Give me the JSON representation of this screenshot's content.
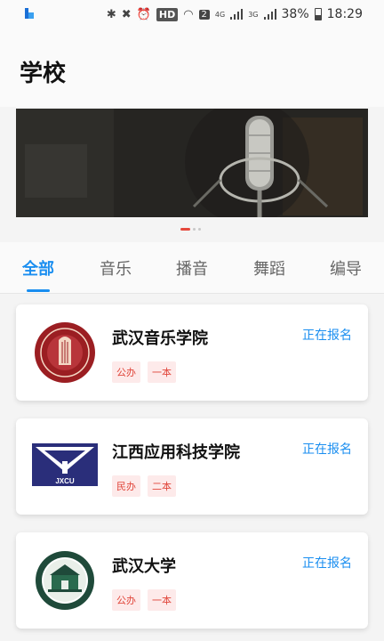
{
  "status_bar": {
    "hd": "HD",
    "sim": "2",
    "net1": "4G",
    "net2": "3G",
    "battery": "38%",
    "time": "18:29"
  },
  "header": {
    "title": "学校"
  },
  "carousel": {
    "slide_count": 3,
    "active_index": 0
  },
  "tabs": [
    {
      "label": "全部",
      "active": true
    },
    {
      "label": "音乐",
      "active": false
    },
    {
      "label": "播音",
      "active": false
    },
    {
      "label": "舞蹈",
      "active": false
    },
    {
      "label": "编导",
      "active": false
    }
  ],
  "schools": [
    {
      "name": "武汉音乐学院",
      "status": "正在报名",
      "tags": [
        "公办",
        "一本"
      ]
    },
    {
      "name": "江西应用科技学院",
      "status": "正在报名",
      "tags": [
        "民办",
        "二本"
      ]
    },
    {
      "name": "武汉大学",
      "status": "正在报名",
      "tags": [
        "公办",
        "一本"
      ]
    }
  ],
  "logo_texts": {
    "jxcu": "JXCU"
  },
  "colors": {
    "accent": "#1a8ef0",
    "tag_text": "#e0453a",
    "tag_bg": "#fdeaea",
    "dot_active": "#e5493d"
  }
}
